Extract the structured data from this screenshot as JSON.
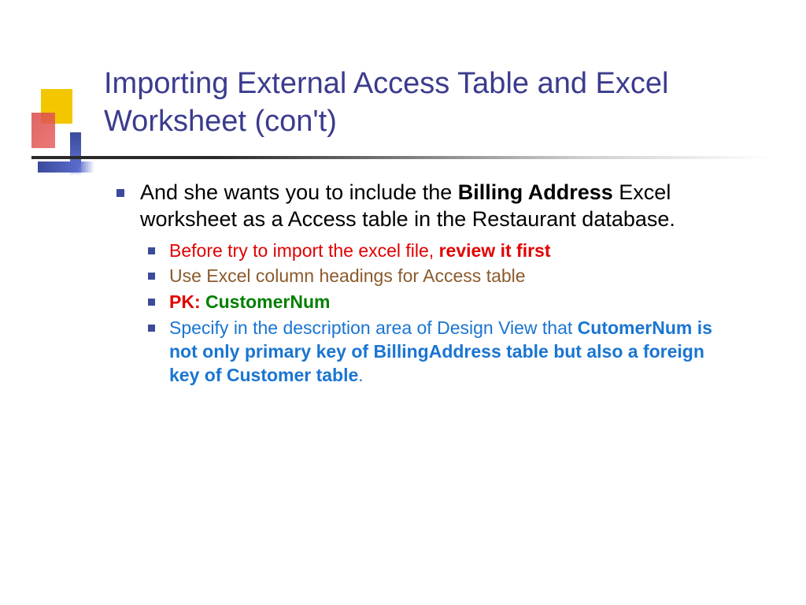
{
  "title": "Importing External Access Table and Excel Worksheet (con't)",
  "main_bullet": {
    "prefix": "And she wants you to include the ",
    "bold_term": "Billing Address",
    "suffix": " Excel worksheet as a Access table in the Restaurant database."
  },
  "sub": [
    {
      "prefix": "Before try to import the excel file, ",
      "bold": "review it first"
    },
    {
      "text": "Use Excel column headings for Access table"
    },
    {
      "pk_label": "PK:",
      "pk_value": " CustomerNum"
    },
    {
      "prefix": "Specify in the description area of Design View that ",
      "bold": "CutomerNum is not only primary key of BillingAddress table but also a foreign key of Customer table",
      "suffix": "."
    }
  ]
}
